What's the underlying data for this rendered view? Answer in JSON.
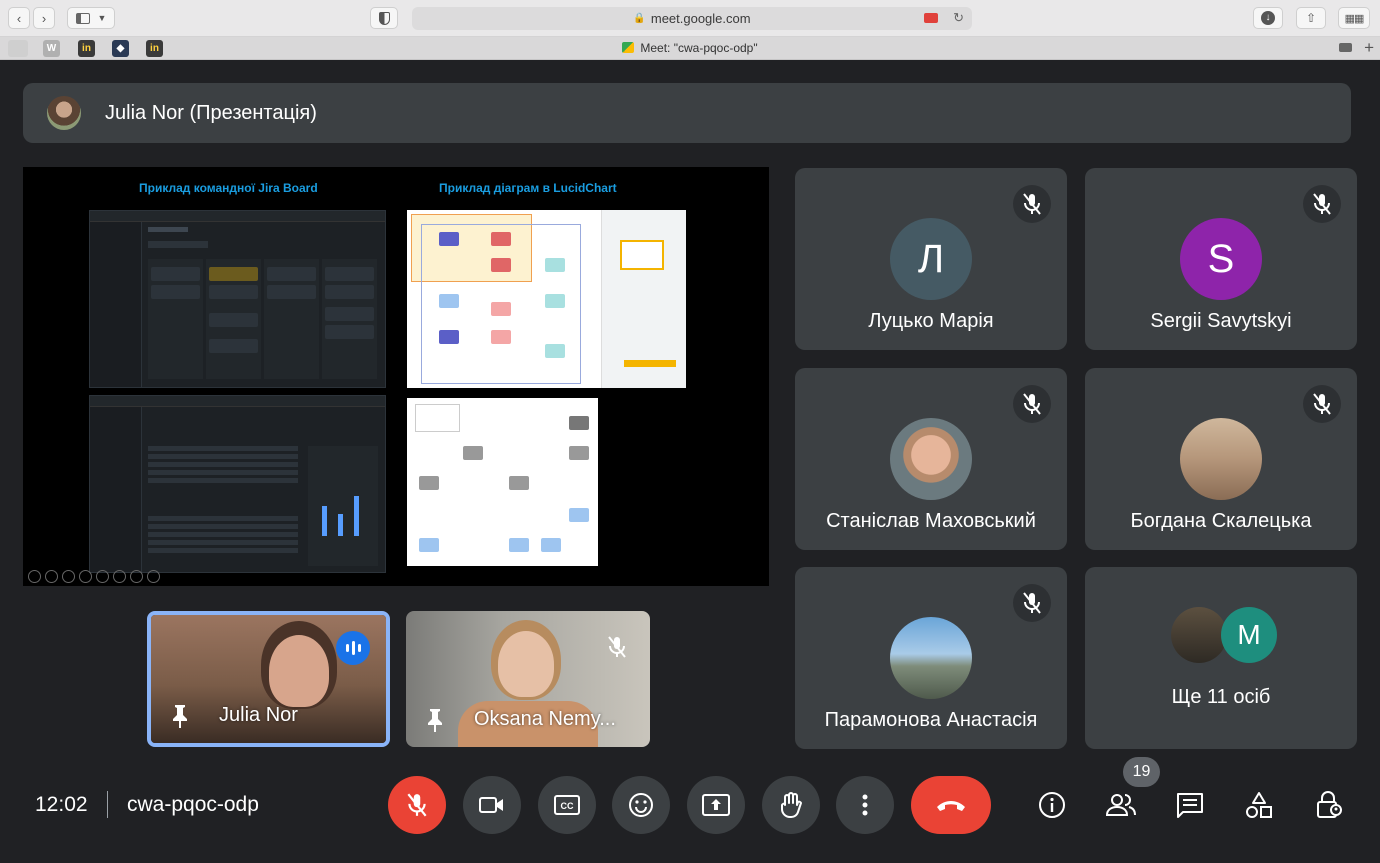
{
  "browser": {
    "url": "meet.google.com",
    "tab_title": "Meet: \"cwa-pqoc-odp\"",
    "pinned_tabs": [
      "W",
      "in",
      "in"
    ]
  },
  "presenter": {
    "name": "Julia Nor (Презентація)"
  },
  "slide": {
    "heading_left": "Приклад командної Jira Board",
    "heading_right": "Приклад діаграм в LucidChart"
  },
  "self_videos": [
    {
      "name": "Julia Nor"
    },
    {
      "name": "Oksana Nemy..."
    }
  ],
  "participants": [
    {
      "name": "Луцько Марія",
      "initial": "Л",
      "color": "#455a64"
    },
    {
      "name": "Sergii Savytskyi",
      "initial": "S",
      "color": "#8e24aa"
    },
    {
      "name": "Станіслав Маховський"
    },
    {
      "name": "Богдана Скалецька"
    },
    {
      "name": "Парамонова Анастасія"
    },
    {
      "name": "Ще 11 осіб",
      "initial": "M",
      "color": "#1e8e7e"
    }
  ],
  "bottom": {
    "time": "12:02",
    "meeting_code": "cwa-pqoc-odp",
    "people_count": "19"
  }
}
